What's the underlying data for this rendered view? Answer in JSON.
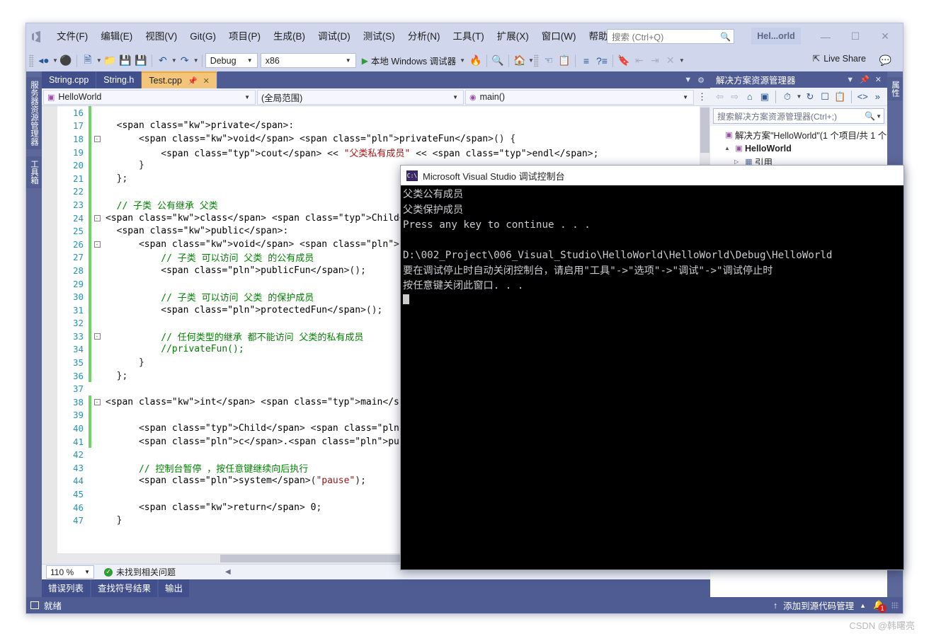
{
  "window": {
    "title": "Hel...orld",
    "minimize": "—",
    "maximize": "☐",
    "close": "✕"
  },
  "menu": {
    "items": [
      {
        "label": "文件(F)"
      },
      {
        "label": "编辑(E)"
      },
      {
        "label": "视图(V)"
      },
      {
        "label": "Git(G)"
      },
      {
        "label": "项目(P)"
      },
      {
        "label": "生成(B)"
      },
      {
        "label": "调试(D)"
      },
      {
        "label": "测试(S)"
      },
      {
        "label": "分析(N)"
      },
      {
        "label": "工具(T)"
      },
      {
        "label": "扩展(X)"
      },
      {
        "label": "窗口(W)"
      },
      {
        "label": "帮助(H)"
      }
    ]
  },
  "quick_search": {
    "placeholder": "搜索 (Ctrl+Q)",
    "icon": "search-icon"
  },
  "toolbar": {
    "config": "Debug",
    "platform": "x86",
    "run_label": "本地 Windows 调试器",
    "live_share": "Live Share"
  },
  "left_dock": {
    "tabs": [
      "服务器资源管理器",
      "工具箱"
    ]
  },
  "right_dock": {
    "tabs": [
      "属性"
    ]
  },
  "document_tabs": [
    {
      "label": "String.cpp",
      "active": false
    },
    {
      "label": "String.h",
      "active": false
    },
    {
      "label": "Test.cpp",
      "active": true
    }
  ],
  "nav_bar": {
    "project": "HelloWorld",
    "scope": "(全局范围)",
    "member": "main()"
  },
  "editor": {
    "zoom": "110 %",
    "status": "未找到相关问题",
    "first_line": 16,
    "lines": [
      {
        "n": 16,
        "mod": true,
        "fold": "",
        "text": ""
      },
      {
        "n": 17,
        "mod": true,
        "fold": "",
        "text": "  private:"
      },
      {
        "n": 18,
        "mod": true,
        "fold": "-",
        "text": "      void privateFun() {"
      },
      {
        "n": 19,
        "mod": true,
        "fold": "",
        "text": "          cout << \"父类私有成员\" << endl;"
      },
      {
        "n": 20,
        "mod": true,
        "fold": "",
        "text": "      }"
      },
      {
        "n": 21,
        "mod": true,
        "fold": "",
        "text": "  };"
      },
      {
        "n": 22,
        "mod": true,
        "fold": "",
        "text": ""
      },
      {
        "n": 23,
        "mod": true,
        "fold": "",
        "text": "  // 子类 公有继承 父类"
      },
      {
        "n": 24,
        "mod": true,
        "fold": "-",
        "text": "class Child : public Parent {"
      },
      {
        "n": 25,
        "mod": true,
        "fold": "",
        "text": "  public:"
      },
      {
        "n": 26,
        "mod": true,
        "fold": "-",
        "text": "      void publicFunChild() {"
      },
      {
        "n": 27,
        "mod": true,
        "fold": "",
        "text": "          // 子类 可以访问 父类 的公有成员"
      },
      {
        "n": 28,
        "mod": true,
        "fold": "",
        "text": "          publicFun();"
      },
      {
        "n": 29,
        "mod": true,
        "fold": "",
        "text": ""
      },
      {
        "n": 30,
        "mod": true,
        "fold": "",
        "text": "          // 子类 可以访问 父类 的保护成员"
      },
      {
        "n": 31,
        "mod": true,
        "fold": "",
        "text": "          protectedFun();"
      },
      {
        "n": 32,
        "mod": true,
        "fold": "",
        "text": ""
      },
      {
        "n": 33,
        "mod": true,
        "fold": "-",
        "text": "          // 任何类型的继承 都不能访问 父类的私有成员"
      },
      {
        "n": 34,
        "mod": true,
        "fold": "",
        "text": "          //privateFun();"
      },
      {
        "n": 35,
        "mod": true,
        "fold": "",
        "text": "      }"
      },
      {
        "n": 36,
        "mod": true,
        "fold": "",
        "text": "  };"
      },
      {
        "n": 37,
        "mod": false,
        "fold": "",
        "text": ""
      },
      {
        "n": 38,
        "mod": true,
        "fold": "-",
        "text": "int main() {"
      },
      {
        "n": 39,
        "mod": true,
        "fold": "",
        "text": ""
      },
      {
        "n": 40,
        "mod": true,
        "fold": "",
        "text": "      Child c;"
      },
      {
        "n": 41,
        "mod": true,
        "fold": "",
        "text": "      c.publicFunChild();"
      },
      {
        "n": 42,
        "mod": false,
        "fold": "",
        "text": ""
      },
      {
        "n": 43,
        "mod": false,
        "fold": "",
        "text": "      // 控制台暂停 ，按任意键继续向后执行"
      },
      {
        "n": 44,
        "mod": false,
        "fold": "",
        "text": "      system(\"pause\");"
      },
      {
        "n": 45,
        "mod": false,
        "fold": "",
        "text": ""
      },
      {
        "n": 46,
        "mod": false,
        "fold": "",
        "text": "      return 0;"
      },
      {
        "n": 47,
        "mod": false,
        "fold": "",
        "text": "  }"
      }
    ]
  },
  "bottom_tabs": [
    "错误列表",
    "查找符号结果",
    "输出"
  ],
  "solution_explorer": {
    "title": "解决方案资源管理器",
    "search_placeholder": "搜索解决方案资源管理器(Ctrl+;)",
    "tree": [
      {
        "label": "解决方案\"HelloWorld\"(1 个项目/共 1 个",
        "icon": "solution-icon",
        "bold": false,
        "indent": 0,
        "twisty": ""
      },
      {
        "label": "HelloWorld",
        "icon": "project-icon",
        "bold": true,
        "indent": 1,
        "twisty": "▲"
      },
      {
        "label": "引用",
        "icon": "references-icon",
        "bold": false,
        "indent": 2,
        "twisty": "▷"
      }
    ]
  },
  "console": {
    "title": "Microsoft Visual Studio 调试控制台",
    "icon": "console-icon",
    "lines": [
      "父类公有成员",
      "父类保护成员",
      "Press any key to continue . . .",
      "",
      "D:\\002_Project\\006_Visual_Studio\\HelloWorld\\HelloWorld\\Debug\\HelloWorld",
      "要在调试停止时自动关闭控制台，请启用\"工具\"->\"选项\"->\"调试\"->\"调试停止时",
      "按任意键关闭此窗口. . ."
    ]
  },
  "statusbar": {
    "state": "就绪",
    "source_control": "添加到源代码管理",
    "notification_count": "1"
  },
  "watermark": "CSDN @韩曙亮",
  "colors": {
    "chrome": "#d0d7ec",
    "dock": "#4f5b93",
    "active_tab": "#f3c57b",
    "accent": "#2b5797",
    "modified_bar": "#71d16b",
    "error_badge": "#cf2020"
  }
}
